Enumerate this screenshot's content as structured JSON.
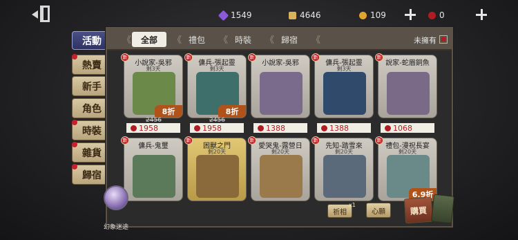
{
  "currencies": {
    "gems": "1549",
    "fragments": "4646",
    "coins": "109",
    "red_gems": "0"
  },
  "side_tabs": [
    {
      "label": "活動",
      "active": true,
      "dot": false
    },
    {
      "label": "熱賣",
      "active": false,
      "dot": true
    },
    {
      "label": "新手",
      "active": false,
      "dot": false
    },
    {
      "label": "角色",
      "active": false,
      "dot": false
    },
    {
      "label": "時裝",
      "active": false,
      "dot": true
    },
    {
      "label": "雜貨",
      "active": false,
      "dot": true
    },
    {
      "label": "歸宿",
      "active": false,
      "dot": true
    }
  ],
  "categories": {
    "all": "全部",
    "gift": "禮包",
    "costume": "時裝",
    "home": "歸宿",
    "more": "",
    "unowned": "未擁有"
  },
  "items": [
    {
      "name": "小說家-吳邪",
      "days": "剩3天",
      "discount": "8折",
      "orig": "2456",
      "price": "1958",
      "art": "#6b8a4a"
    },
    {
      "name": "傭兵-張起靈",
      "days": "剩3天",
      "discount": "8折",
      "orig": "2456",
      "price": "1958",
      "art": "#3f6f6a"
    },
    {
      "name": "小說家-吳邪",
      "days": "",
      "discount": "",
      "orig": "",
      "price": "1388",
      "art": "#7a6a8c"
    },
    {
      "name": "傭兵-張起靈",
      "days": "剩3天",
      "discount": "",
      "orig": "",
      "price": "1388",
      "art": "#2f4a6a"
    },
    {
      "name": "說家-蛇眉銅魚",
      "days": "",
      "discount": "",
      "orig": "",
      "price": "1068",
      "art": "#7a6a88"
    },
    {
      "name": "傭兵-鬼璽",
      "days": "",
      "discount": "",
      "orig": "",
      "price": "",
      "art": "#5a7a5a"
    },
    {
      "name": "困獸之門",
      "days": "剩20天",
      "discount": "",
      "orig": "",
      "price": "",
      "art": "#8a6a3a"
    },
    {
      "name": "愛哭鬼-露營日",
      "days": "剩20天",
      "discount": "",
      "orig": "",
      "price": "",
      "art": "#9a7a4a"
    },
    {
      "name": "先知-踏雪來",
      "days": "剩20天",
      "discount": "",
      "orig": "",
      "price": "",
      "art": "#5a6a7a"
    },
    {
      "name": "禮包-漫祝長宴",
      "days": "剩20天",
      "discount": "6.9折",
      "orig": "",
      "price": "",
      "art": "#6a8a8a"
    }
  ],
  "bottom": {
    "crystal_label": "幻象迷途",
    "btn_a": "祈相",
    "btn_a_badge": "x1",
    "btn_b": "心願",
    "btn_c": "購買"
  },
  "colors": {
    "accent_red": "#b01c24",
    "discount_orange": "#b0531a",
    "active_tab": "#3a3f74",
    "panel_frame": "#5d5243"
  }
}
